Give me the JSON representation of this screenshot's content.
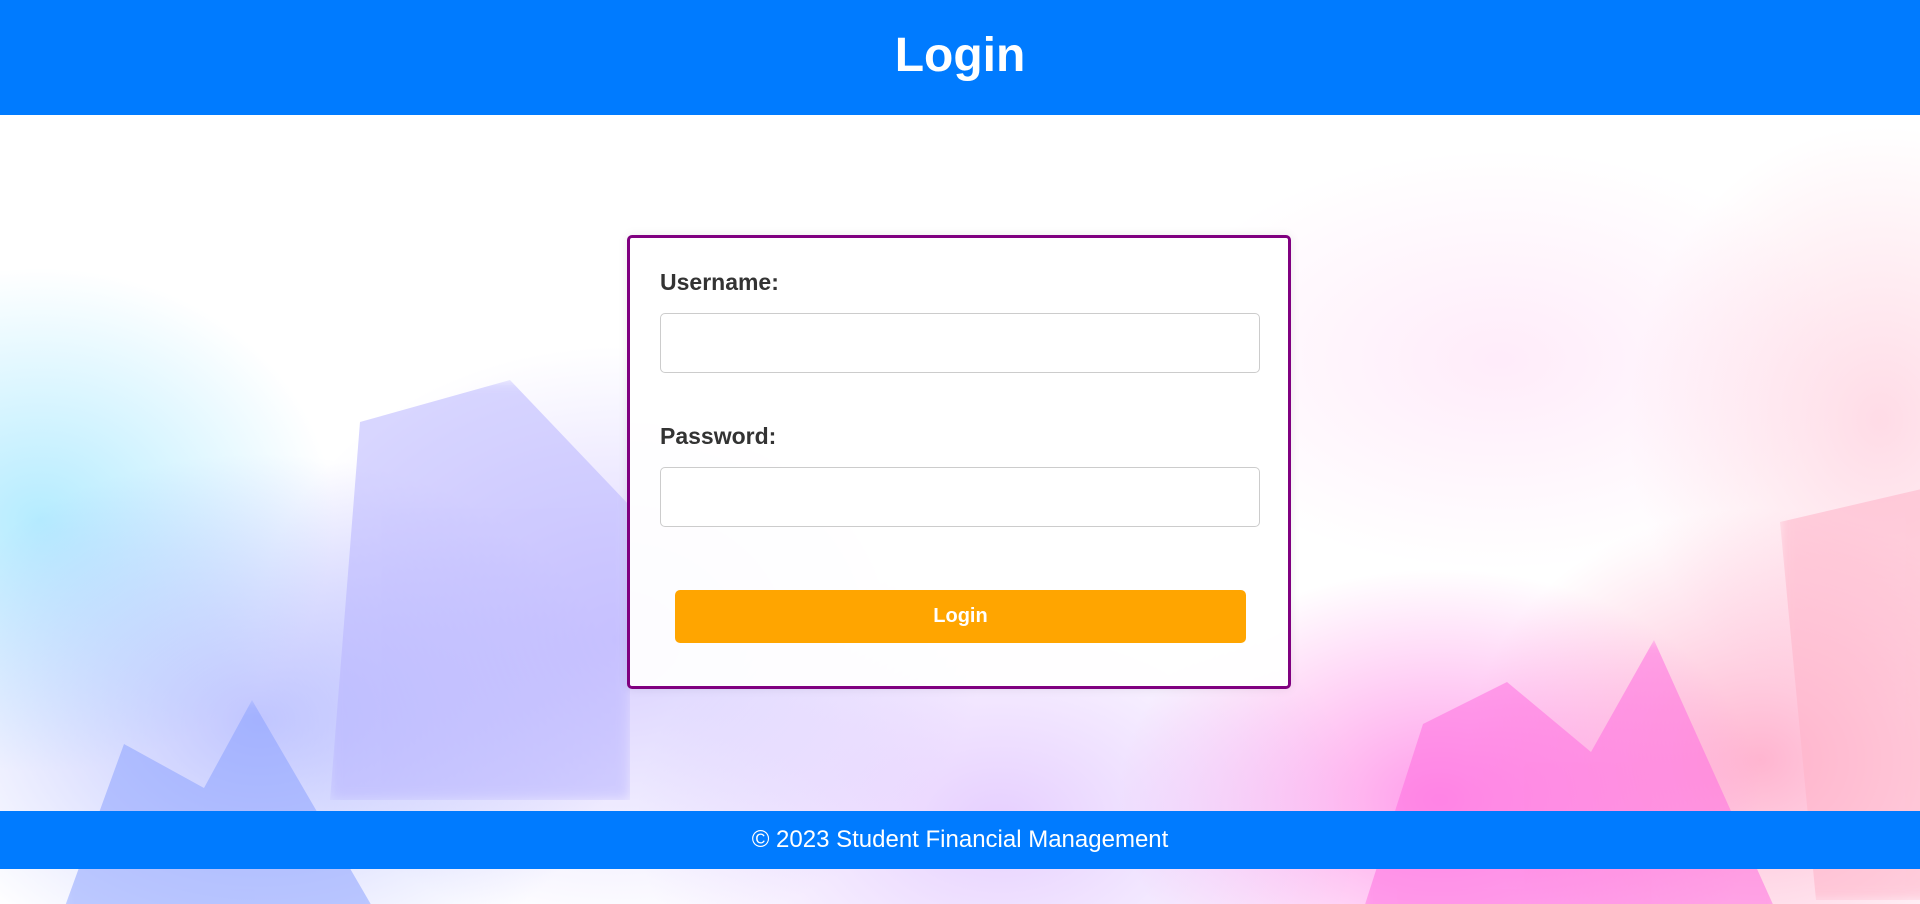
{
  "header": {
    "title": "Login"
  },
  "login_form": {
    "username_label": "Username:",
    "username_value": "",
    "password_label": "Password:",
    "password_value": "",
    "submit_label": "Login"
  },
  "footer": {
    "text": "© 2023 Student Financial Management"
  },
  "colors": {
    "header_bg": "#007bff",
    "footer_bg": "#007bff",
    "card_border": "#800080",
    "button_bg": "#ffa500",
    "button_text": "#ffffff"
  }
}
